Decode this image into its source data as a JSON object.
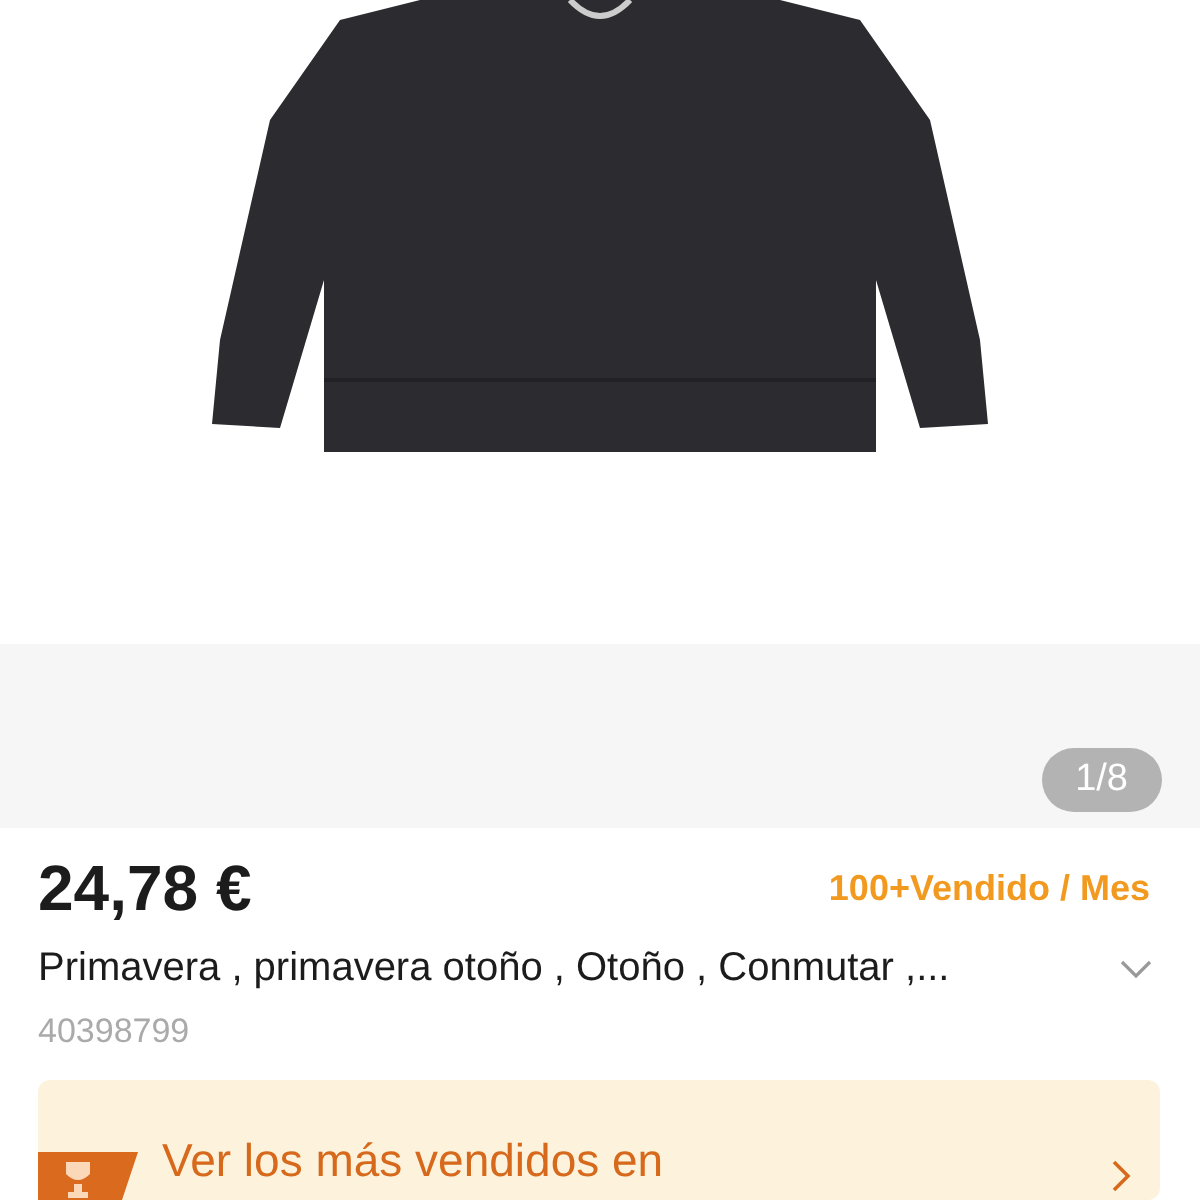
{
  "gallery": {
    "counter": "1/8"
  },
  "product": {
    "price": "24,78 €",
    "sales": "100+Vendido / Mes",
    "title": "Primavera , primavera otoño , Otoño , Conmutar ,...",
    "id": "40398799"
  },
  "banner": {
    "text": "Ver los más vendidos en"
  }
}
